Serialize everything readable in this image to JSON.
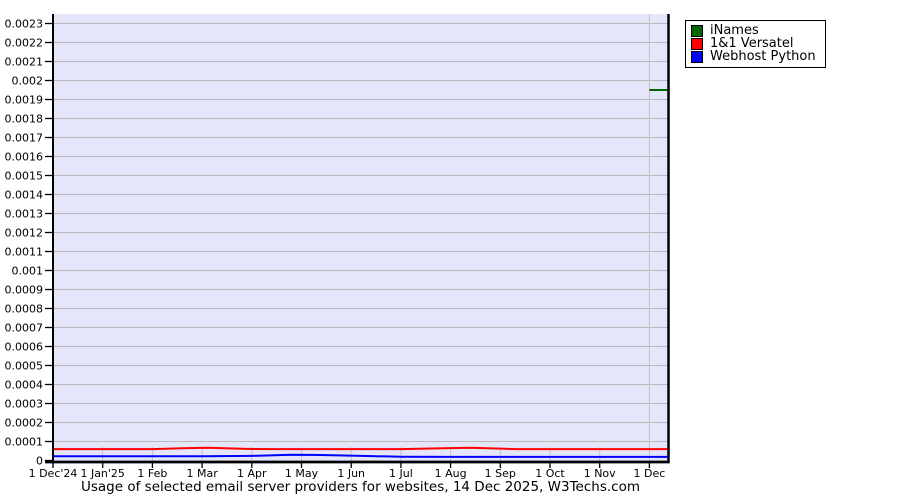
{
  "chart_data": {
    "type": "line",
    "title": "Usage of selected email server providers for websites, 14 Dec 2025, W3Techs.com",
    "x_unit": "months since 1 Dec'24; chart right edge is 14 Dec 2025 (offset 12.37)",
    "x_ticks": [
      "1 Dec'24",
      "1 Jan'25",
      "1 Feb",
      "1 Mar",
      "1 Apr",
      "1 May",
      "1 Jun",
      "1 Jul",
      "1 Aug",
      "1 Sep",
      "1 Oct",
      "1 Nov",
      "1 Dec"
    ],
    "y_ticks": [
      "0.0023",
      "0.0022",
      "0.0021",
      "0.002",
      "0.0019",
      "0.0018",
      "0.0017",
      "0.0016",
      "0.0015",
      "0.0014",
      "0.0013",
      "0.0012",
      "0.0011",
      "0.001",
      "0.0009",
      "0.0008",
      "0.0007",
      "0.0006",
      "0.0005",
      "0.0004",
      "0.0003",
      "0.0002",
      "0.0001",
      "0"
    ],
    "ylim": [
      0,
      0.00235
    ],
    "grid": true,
    "legend_position": "outside-top-right",
    "colors": {
      "plot_bg": "#e6e6fa",
      "grid_h": "#b9b9b9",
      "grid_v": "#c2c2c2",
      "axis": "#000000"
    },
    "series": [
      {
        "name": "iNames",
        "color": "#006600",
        "points": [
          [
            12,
            0.00195
          ],
          [
            12.37,
            0.00195
          ]
        ]
      },
      {
        "name": "1&1 Versatel",
        "color": "#ff0000",
        "points": [
          [
            0,
            6e-05
          ],
          [
            1,
            6e-05
          ],
          [
            2,
            6e-05
          ],
          [
            2.6,
            6.4e-05
          ],
          [
            3.1,
            6.7e-05
          ],
          [
            3.9,
            6.1e-05
          ],
          [
            4.5,
            6e-05
          ],
          [
            6,
            6e-05
          ],
          [
            7,
            6e-05
          ],
          [
            7.6,
            6.3e-05
          ],
          [
            8.4,
            6.7e-05
          ],
          [
            9.3,
            6e-05
          ],
          [
            10,
            6e-05
          ],
          [
            11,
            6e-05
          ],
          [
            12,
            6e-05
          ],
          [
            12.37,
            6e-05
          ]
        ]
      },
      {
        "name": "Webhost Python",
        "color": "#0000ff",
        "points": [
          [
            0,
            2.2e-05
          ],
          [
            1,
            2.2e-05
          ],
          [
            2,
            2.2e-05
          ],
          [
            3,
            2.2e-05
          ],
          [
            4,
            2.4e-05
          ],
          [
            4.8,
            3e-05
          ],
          [
            5.4,
            2.9e-05
          ],
          [
            6.2,
            2.4e-05
          ],
          [
            7,
            2e-05
          ],
          [
            8,
            1.9e-05
          ],
          [
            9,
            1.9e-05
          ],
          [
            10,
            1.9e-05
          ],
          [
            11,
            1.9e-05
          ],
          [
            12,
            1.9e-05
          ],
          [
            12.37,
            1.9e-05
          ]
        ]
      }
    ]
  }
}
